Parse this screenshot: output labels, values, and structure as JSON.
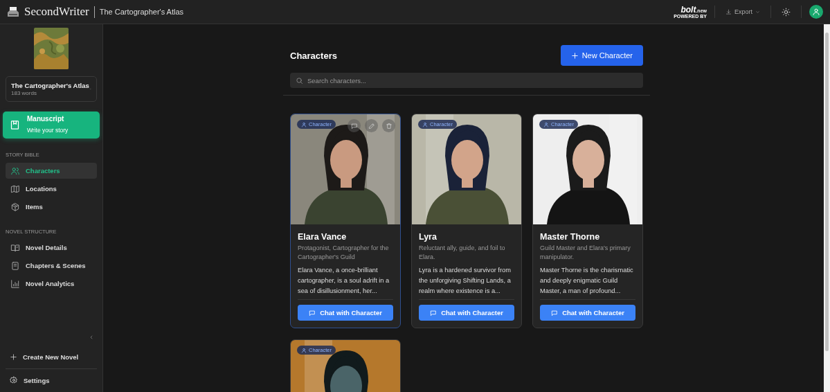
{
  "header": {
    "app_name": "SecondWriter",
    "novel_title": "The Cartographer's Atlas",
    "bolt": {
      "logo": "bolt",
      "suffix": ".new",
      "caption": "POWERED BY"
    },
    "export_label": "Export"
  },
  "sidebar": {
    "novel": {
      "title": "The Cartographer's Atlas",
      "words": "183 words"
    },
    "manuscript": {
      "title": "Manuscript",
      "subtitle": "Write your story"
    },
    "sections": [
      {
        "heading": "STORY BIBLE",
        "items": [
          {
            "label": "Characters",
            "selected": true
          },
          {
            "label": "Locations",
            "selected": false
          },
          {
            "label": "Items",
            "selected": false
          }
        ]
      },
      {
        "heading": "NOVEL STRUCTURE",
        "items": [
          {
            "label": "Novel Details",
            "selected": false
          },
          {
            "label": "Chapters & Scenes",
            "selected": false
          },
          {
            "label": "Novel Analytics",
            "selected": false
          }
        ]
      }
    ],
    "create_label": "Create New Novel",
    "settings_label": "Settings"
  },
  "main": {
    "title": "Characters",
    "new_button": "New Character",
    "search": {
      "placeholder": "Search characters..."
    },
    "cards": [
      {
        "badge": "Character",
        "selected": true,
        "name": "Elara Vance",
        "role": "Protagonist, Cartographer for the Cartographer's Guild",
        "description": "Elara Vance, a once-brilliant cartographer, is a soul adrift in a sea of disillusionment, her...",
        "chat_label": "Chat with Character"
      },
      {
        "badge": "Character",
        "selected": false,
        "name": "Lyra",
        "role": "Reluctant ally, guide, and foil to Elara.",
        "description": "Lyra is a hardened survivor from the unforgiving Shifting Lands, a realm where existence is a...",
        "chat_label": "Chat with Character"
      },
      {
        "badge": "Character",
        "selected": false,
        "name": "Master Thorne",
        "role": "Guild Master and Elara's primary manipulator.",
        "description": "Master Thorne is the charismatic and deeply enigmatic Guild Master, a man of profound...",
        "chat_label": "Chat with Character"
      },
      {
        "badge": "Character",
        "selected": false
      }
    ]
  }
}
